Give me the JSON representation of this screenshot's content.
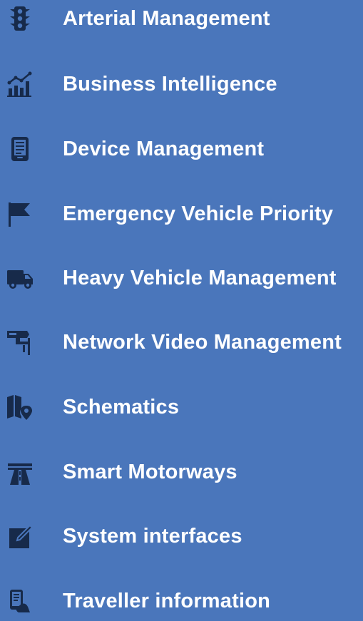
{
  "colors": {
    "background": "#4a76bb",
    "text": "#ffffff",
    "icon": "#172a4a"
  },
  "menu": {
    "items": [
      {
        "label": "Arterial Management",
        "icon": "traffic-light-icon"
      },
      {
        "label": "Business Intelligence",
        "icon": "bar-chart-trend-icon"
      },
      {
        "label": "Device Management",
        "icon": "tablet-device-icon"
      },
      {
        "label": "Emergency Vehicle Priority",
        "icon": "flag-icon"
      },
      {
        "label": "Heavy Vehicle Management",
        "icon": "truck-icon"
      },
      {
        "label": "Network Video Management",
        "icon": "security-camera-icon"
      },
      {
        "label": "Schematics",
        "icon": "map-pin-icon"
      },
      {
        "label": "Smart Motorways",
        "icon": "motorway-icon"
      },
      {
        "label": "System interfaces",
        "icon": "edit-square-icon"
      },
      {
        "label": "Traveller information",
        "icon": "hand-device-icon"
      }
    ]
  }
}
